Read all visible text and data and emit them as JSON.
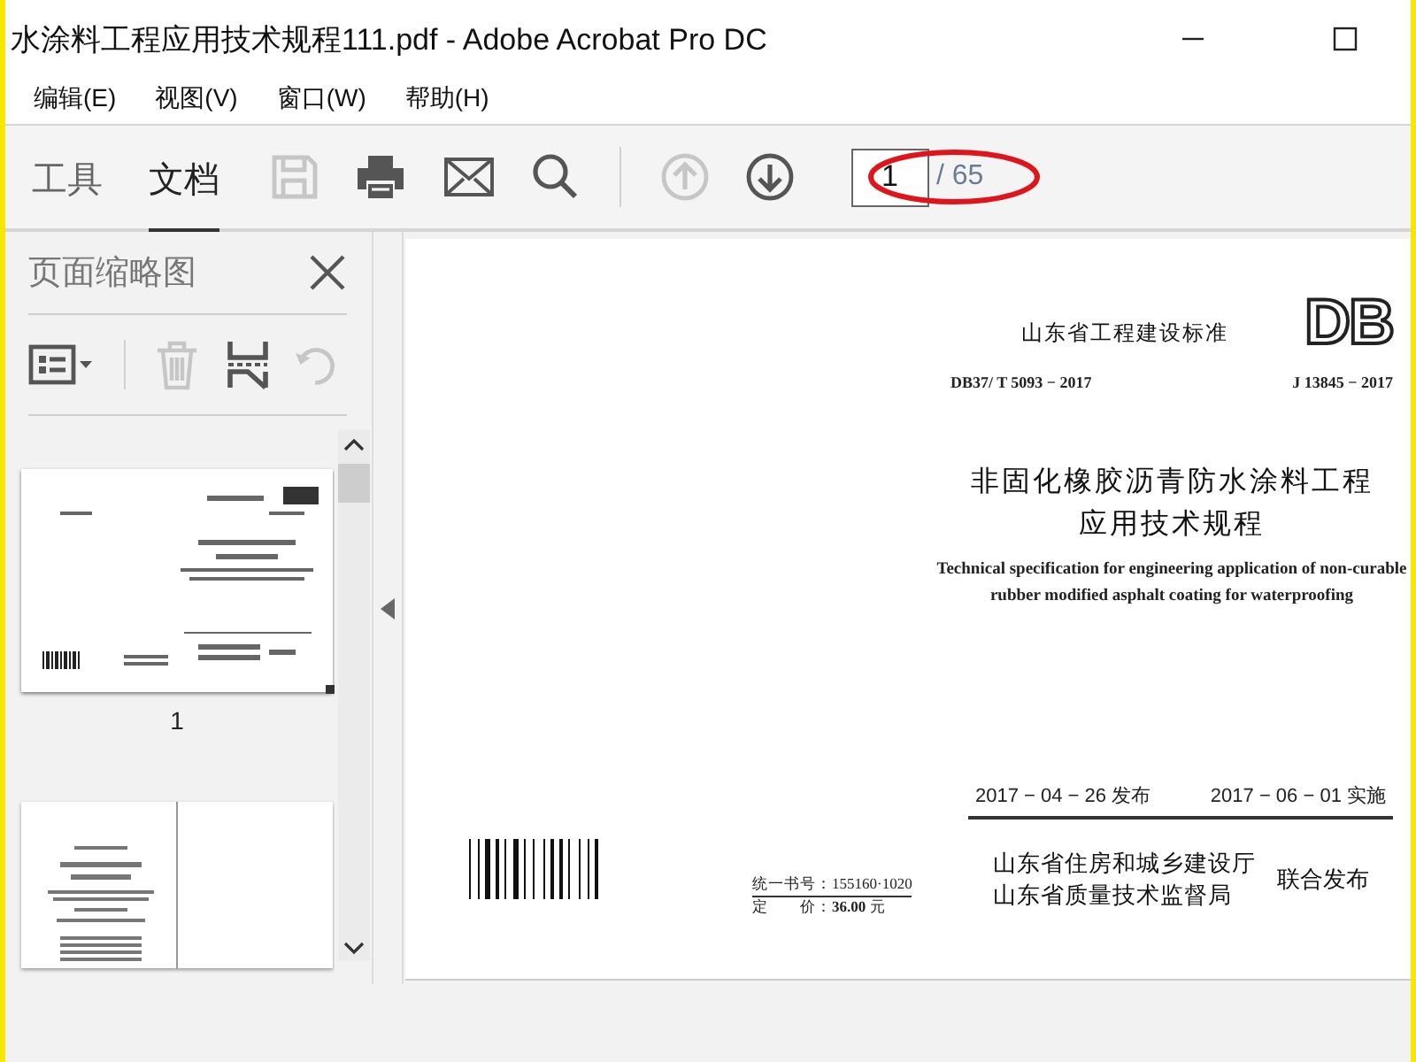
{
  "window": {
    "title": "水涂料工程应用技术规程111.pdf - Adobe Acrobat Pro DC"
  },
  "menu": [
    "编辑(E)",
    "视图(V)",
    "窗口(W)",
    "帮助(H)"
  ],
  "tabs": [
    {
      "label": "工具",
      "selected": false
    },
    {
      "label": "文档",
      "selected": true
    }
  ],
  "toolbar": [
    {
      "kind": "save",
      "disabled": true
    },
    {
      "kind": "print",
      "disabled": false
    },
    {
      "kind": "mail",
      "disabled": false
    },
    {
      "kind": "search",
      "disabled": false
    },
    {
      "kind": "sep"
    },
    {
      "kind": "up",
      "disabled": true
    },
    {
      "kind": "down",
      "disabled": false
    }
  ],
  "page_nav": {
    "value": "1",
    "total": "/ 65"
  },
  "sidebar": {
    "title": "页面缩略图",
    "tools": [
      {
        "kind": "options",
        "disabled": false
      },
      {
        "kind": "sep"
      },
      {
        "kind": "delete",
        "disabled": true
      },
      {
        "kind": "extract",
        "disabled": false
      },
      {
        "kind": "rotate",
        "disabled": true
      }
    ],
    "thumbnails": [
      {
        "kind": "cover",
        "label": "1",
        "selected": true
      },
      {
        "kind": "spread",
        "selected": false
      }
    ]
  },
  "document": {
    "header": "山东省工程建设标准",
    "logo": "DB",
    "code_left": "DB37/ T 5093 − 2017",
    "code_right": "J 13845 − 2017",
    "title_lines": [
      "非固化橡胶沥青防水涂料工程",
      "应用技术规程"
    ],
    "subtitle_lines": [
      "Technical specification for engineering application of non-curable",
      "rubber modified asphalt coating for waterproofing"
    ],
    "issue_date": "2017 − 04 − 26 发布",
    "effective_date": "2017 − 06 − 01 实施",
    "book_number": "统一书号：155160·1020",
    "price": "定　　价：**36.00** 元",
    "publishers": [
      "山东省住房和城乡建设厅",
      "山东省质量技术监督局"
    ],
    "joint": "联合发布"
  }
}
